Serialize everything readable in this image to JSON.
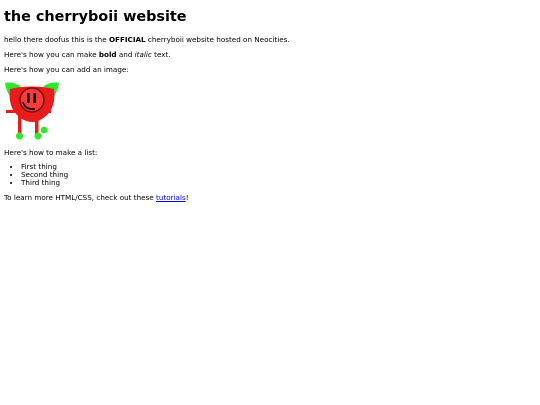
{
  "page": {
    "title": "the cherryboii website",
    "intro": {
      "before": "hello there doofus this is the ",
      "bold": "OFFICIAL",
      "after": " cherryboii website hosted on Neocities."
    },
    "formatting": {
      "before": "Here's how you can make ",
      "bold": "bold",
      "middle": " and ",
      "italic": "italic",
      "after": " text."
    },
    "image_text": "Here's how you can add an image:",
    "list_text": "Here's how to make a list:",
    "list_items": [
      "First thing",
      "Second thing",
      "Third thing"
    ],
    "learn": {
      "before": "To learn more HTML/CSS, check out these ",
      "link": "tutorials",
      "after": "!"
    }
  },
  "colors": {
    "link": "#0000ee",
    "leaf_green": "#2ee82e",
    "cherry_red": "#e81c1c"
  },
  "image": {
    "icon": "cherry-character-icon"
  }
}
